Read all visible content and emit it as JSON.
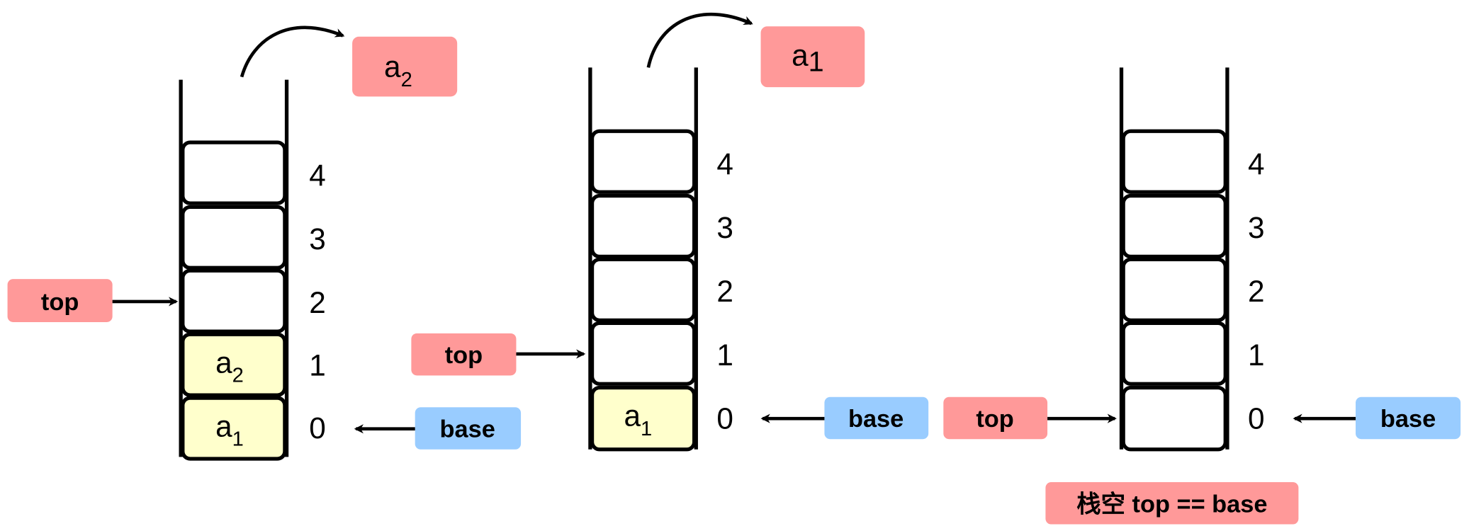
{
  "colors": {
    "pointer_top": "#ff9999",
    "pointer_base": "#99ccff",
    "filled_cell": "#ffffcc",
    "empty_cell": "#ffffff"
  },
  "indices": [
    "4",
    "3",
    "2",
    "1",
    "0"
  ],
  "stack1": {
    "cells": [
      {
        "base": "",
        "sub": ""
      },
      {
        "base": "",
        "sub": ""
      },
      {
        "base": "",
        "sub": ""
      },
      {
        "base": "a",
        "sub": "2"
      },
      {
        "base": "a",
        "sub": "1"
      }
    ],
    "popped": {
      "base": "a",
      "sub": "2"
    },
    "top_label": "top",
    "base_label": "base"
  },
  "stack2": {
    "cells": [
      {
        "base": "",
        "sub": ""
      },
      {
        "base": "",
        "sub": ""
      },
      {
        "base": "",
        "sub": ""
      },
      {
        "base": "",
        "sub": ""
      },
      {
        "base": "a",
        "sub": "1"
      }
    ],
    "popped": {
      "base": "a",
      "sub": "1"
    },
    "top_label": "top",
    "base_label": "base"
  },
  "stack3": {
    "top_label": "top",
    "base_label": "base",
    "caption": "栈空 top == base"
  }
}
